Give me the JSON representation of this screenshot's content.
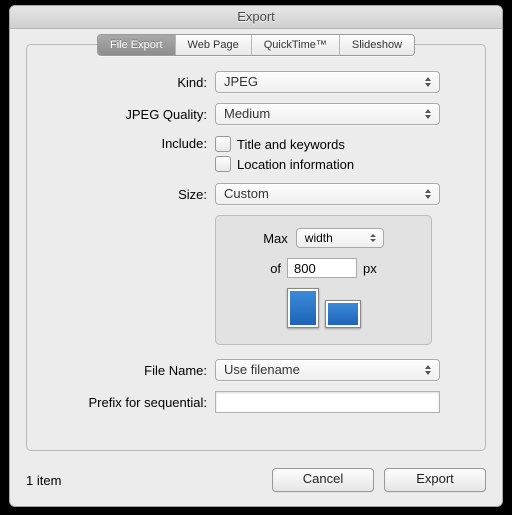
{
  "window": {
    "title": "Export"
  },
  "tabs": [
    {
      "label": "File Export",
      "selected": true
    },
    {
      "label": "Web Page"
    },
    {
      "label": "QuickTime™"
    },
    {
      "label": "Slideshow"
    }
  ],
  "labels": {
    "kind": "Kind:",
    "jpeg_quality": "JPEG Quality:",
    "include": "Include:",
    "size": "Size:",
    "file_name": "File Name:",
    "prefix": "Prefix for sequential:",
    "max": "Max",
    "of": "of",
    "px": "px"
  },
  "values": {
    "kind": "JPEG",
    "jpeg_quality": "Medium",
    "include_title": "Title and keywords",
    "include_location": "Location information",
    "size": "Custom",
    "dimension_mode": "width",
    "dimension_value": "800",
    "file_name": "Use filename",
    "prefix": ""
  },
  "footer": {
    "item_count": "1 item",
    "cancel": "Cancel",
    "export": "Export"
  }
}
